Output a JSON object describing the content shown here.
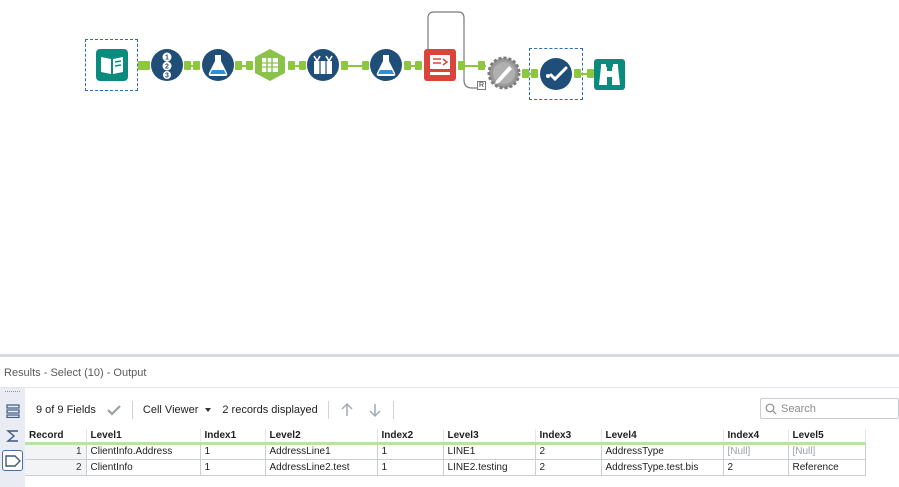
{
  "workflow": {
    "tools": [
      {
        "name": "input-data-tool",
        "icon": "book-icon"
      },
      {
        "name": "record-id-tool",
        "icon": "numbered-list-icon"
      },
      {
        "name": "formula-tool-1",
        "icon": "flask-icon"
      },
      {
        "name": "text-to-columns-tool",
        "icon": "columns-icon"
      },
      {
        "name": "transpose-tool",
        "icon": "table-transpose-icon"
      },
      {
        "name": "formula-tool-2",
        "icon": "flask-icon"
      },
      {
        "name": "dynamic-rename-tool",
        "icon": "rename-icon"
      },
      {
        "name": "crosstab-tool",
        "icon": "gear-pen-icon"
      },
      {
        "name": "select-tool",
        "icon": "checkmark-icon"
      },
      {
        "name": "browse-tool",
        "icon": "binoculars-icon"
      }
    ],
    "colors": {
      "teal": "#0b8b7e",
      "navy": "#1f4e79",
      "green": "#8bc34a",
      "red": "#d9453a",
      "gray": "#9a9a9a",
      "connector": "#8dc63f"
    },
    "anchor_label": "R"
  },
  "results": {
    "title": "Results - Select (10) - Output",
    "toolbar": {
      "fields_label": "9 of 9 Fields",
      "cell_viewer_label": "Cell Viewer",
      "records_label": "2 records displayed"
    },
    "search_placeholder": "Search",
    "columns": [
      "Record",
      "Level1",
      "Index1",
      "Level2",
      "Index2",
      "Level3",
      "Index3",
      "Level4",
      "Index4",
      "Level5"
    ],
    "rows": [
      [
        "1",
        "ClientInfo.Address",
        "1",
        "AddressLine1",
        "1",
        "LINE1",
        "2",
        "AddressType",
        "[Null]",
        "[Null]"
      ],
      [
        "2",
        "ClientInfo",
        "1",
        "AddressLine2.test",
        "1",
        "LINE2.testing",
        "2",
        "AddressType.test.bis",
        "2",
        "Reference"
      ]
    ]
  }
}
